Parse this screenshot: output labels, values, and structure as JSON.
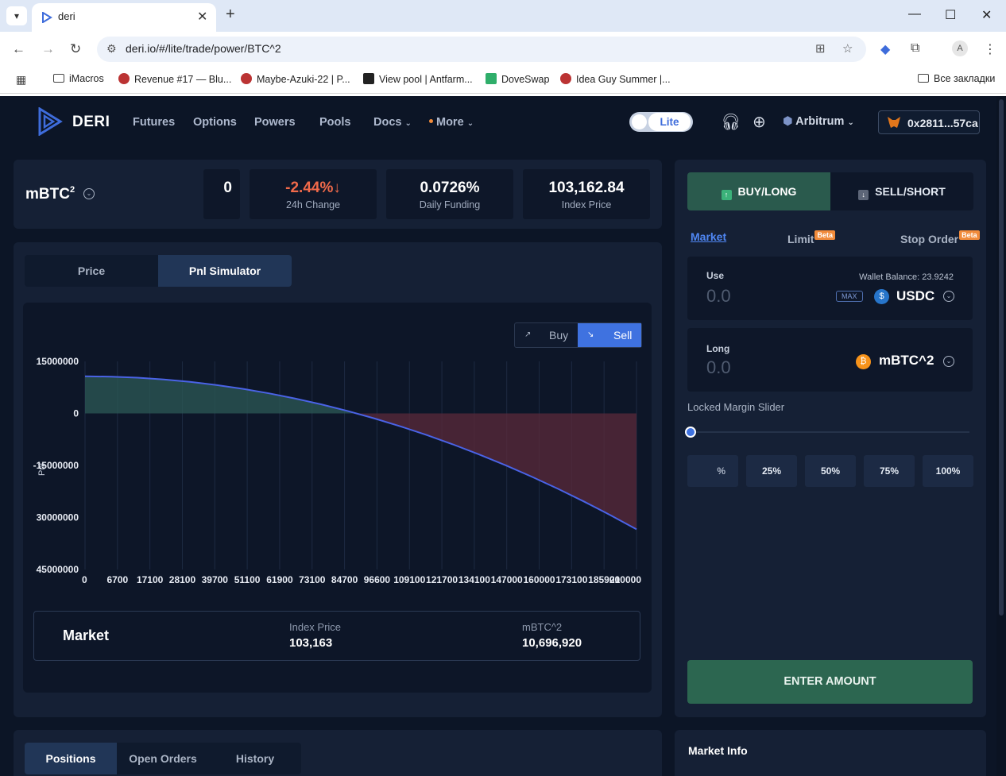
{
  "browser": {
    "tab_title": "deri",
    "url": "deri.io/#/lite/trade/power/BTC^2",
    "bookmarks": [
      {
        "label": "iMacros"
      },
      {
        "label": "Revenue #17 — Blu..."
      },
      {
        "label": "Maybe-Azuki-22 | P..."
      },
      {
        "label": "View pool | Antfarm..."
      },
      {
        "label": "DoveSwap"
      },
      {
        "label": "Idea Guy Summer |..."
      }
    ],
    "all_bookmarks": "Все закладки",
    "profile_initial": "A"
  },
  "nav": {
    "brand": "DERI",
    "links": [
      "Futures",
      "Options",
      "Powers",
      "Pools",
      "Docs",
      "More"
    ],
    "mode": "Lite",
    "network": "Arbitrum",
    "wallet": "0x2811...57ca"
  },
  "ticker": {
    "symbol": "mBTC",
    "sup": "2",
    "partial_stat": "0",
    "change": "-2.44%",
    "change_label": "24h Change",
    "funding": "0.0726%",
    "funding_label": "Daily Funding",
    "index_price": "103,162.84",
    "index_label": "Index Price"
  },
  "chart_tabs": {
    "price": "Price",
    "pnl": "Pnl Simulator"
  },
  "buy_sell": {
    "buy": "Buy",
    "sell": "Sell"
  },
  "chart_data": {
    "type": "area",
    "ylabel": "Pnl",
    "y_ticks": [
      "15000000",
      "0",
      "-15000000",
      "30000000",
      "45000000"
    ],
    "x_ticks": [
      "0",
      "6700",
      "17100",
      "28100",
      "39700",
      "51100",
      "61900",
      "73100",
      "84700",
      "96600",
      "109100",
      "121700",
      "134100",
      "147000",
      "160000",
      "173100",
      "185900",
      "210000"
    ],
    "x": [
      0,
      10000,
      20000,
      30000,
      40000,
      50000,
      60000,
      70000,
      80000,
      90000,
      100000,
      110000,
      120000,
      130000,
      140000,
      150000,
      160000,
      170000,
      180000,
      190000,
      200000,
      210000
    ],
    "y": [
      10696920,
      10596920,
      10296920,
      9796920,
      9096920,
      8196920,
      7096920,
      5796920,
      4296920,
      2596920,
      696920,
      -1403080,
      -3703080,
      -6203080,
      -8903080,
      -11803080,
      -14903080,
      -18203080,
      -21703080,
      -25403080,
      -29303080,
      -33403080
    ],
    "ylim": [
      -45000000,
      15000000
    ],
    "xlim": [
      0,
      210000
    ]
  },
  "market_box": {
    "title": "Market",
    "index_label": "Index Price",
    "index_value": "103,163",
    "asset_label": "mBTC^2",
    "asset_value": "10,696,920"
  },
  "trade": {
    "buy_long": "BUY/LONG",
    "sell_short": "SELL/SHORT",
    "order_types": [
      "Market",
      "Limit",
      "Stop Order"
    ],
    "beta": "Beta",
    "use_label": "Use",
    "use_value": "0.0",
    "wallet_balance": "Wallet Balance: 23.9242",
    "max": "MAX",
    "use_token": "USDC",
    "long_label": "Long",
    "long_value": "0.0",
    "long_token": "mBTC^2",
    "slider_label": "Locked Margin Slider",
    "pct_buttons": [
      "%",
      "25%",
      "50%",
      "75%",
      "100%"
    ],
    "enter": "ENTER AMOUNT"
  },
  "bottom_tabs": [
    "Positions",
    "Open Orders",
    "History"
  ],
  "market_info": "Market Info",
  "colors": {
    "bg": "#0c1526",
    "panel": "#152035",
    "accent_blue": "#3f72e0",
    "negative": "#f16a4a",
    "buy_green": "#2c6650",
    "curve": "#4a63e6"
  }
}
